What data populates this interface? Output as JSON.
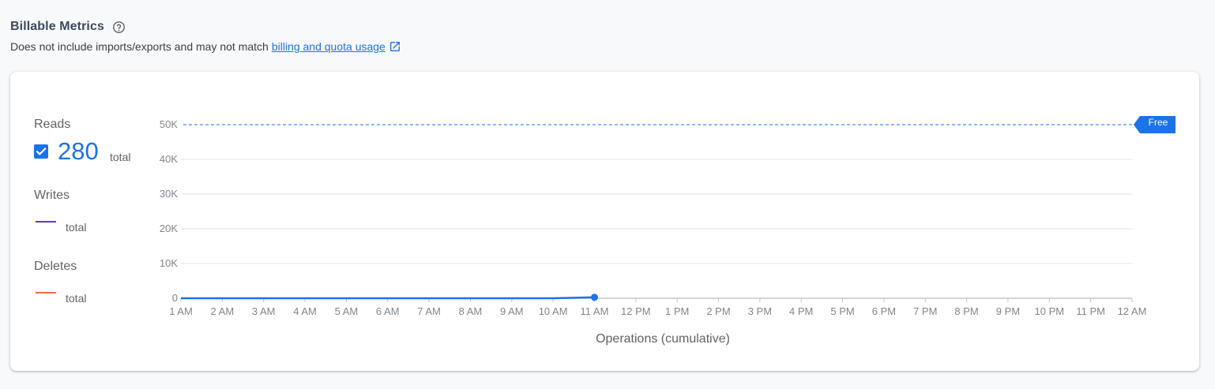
{
  "header": {
    "title": "Billable Metrics",
    "subtitle": "Does not include imports/exports and may not match",
    "link_text": "billing and quota usage"
  },
  "icons": {
    "help": "help-circle-icon",
    "external": "open-in-new-icon",
    "check": "check-icon"
  },
  "legend": {
    "reads": {
      "label": "Reads",
      "value": "280",
      "unit": "total",
      "checked": true
    },
    "writes": {
      "label": "Writes",
      "unit": "total"
    },
    "deletes": {
      "label": "Deletes",
      "unit": "total"
    }
  },
  "colors": {
    "accent": "#1a73e8",
    "writes": "#673ab7",
    "deletes": "#f06c3c",
    "grid": "#e3e3e3",
    "axis": "#c4c7c5"
  },
  "chart_data": {
    "type": "line",
    "xlabel": "Operations (cumulative)",
    "ylabel": "",
    "ylim": [
      0,
      50000
    ],
    "y_ticks": [
      "0",
      "10K",
      "20K",
      "30K",
      "40K",
      "50K"
    ],
    "x": [
      "1 AM",
      "2 AM",
      "3 AM",
      "4 AM",
      "5 AM",
      "6 AM",
      "7 AM",
      "8 AM",
      "9 AM",
      "10 AM",
      "11 AM",
      "12 PM",
      "1 PM",
      "2 PM",
      "3 PM",
      "4 PM",
      "5 PM",
      "6 PM",
      "7 PM",
      "8 PM",
      "9 PM",
      "10 PM",
      "11 PM",
      "12 AM"
    ],
    "grid": true,
    "series": [
      {
        "name": "Reads",
        "values": [
          0,
          0,
          0,
          0,
          0,
          0,
          0,
          0,
          0,
          0,
          280
        ]
      }
    ],
    "threshold": {
      "label": "Free",
      "value": 50000
    }
  }
}
